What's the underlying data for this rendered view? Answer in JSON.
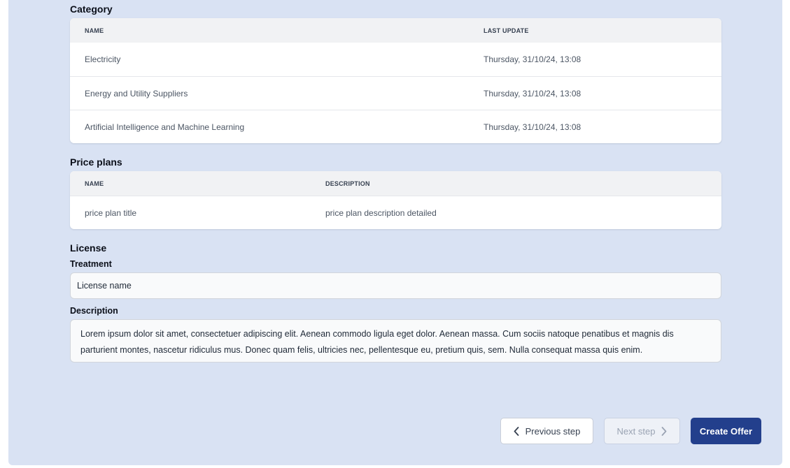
{
  "category": {
    "title": "Category",
    "headers": {
      "name": "NAME",
      "last_update": "LAST UPDATE"
    },
    "rows": [
      {
        "name": "Electricity",
        "last_update": "Thursday, 31/10/24, 13:08"
      },
      {
        "name": "Energy and Utility Suppliers",
        "last_update": "Thursday, 31/10/24, 13:08"
      },
      {
        "name": "Artificial Intelligence and Machine Learning",
        "last_update": "Thursday, 31/10/24, 13:08"
      }
    ]
  },
  "price_plans": {
    "title": "Price plans",
    "headers": {
      "name": "NAME",
      "description": "DESCRIPTION"
    },
    "rows": [
      {
        "name": "price plan title",
        "description": "price plan description detailed"
      }
    ]
  },
  "license": {
    "title": "License",
    "treatment_label": "Treatment",
    "treatment_value": "License name",
    "description_label": "Description",
    "description_value": "Lorem ipsum dolor sit amet, consectetuer adipiscing elit. Aenean commodo ligula eget dolor. Aenean massa. Cum sociis natoque penatibus et magnis dis parturient montes, nascetur ridiculus mus. Donec quam felis, ultricies nec, pellentesque eu, pretium quis, sem. Nulla consequat massa quis enim."
  },
  "actions": {
    "previous_label": "Previous step",
    "next_label": "Next step",
    "create_label": "Create Offer"
  },
  "icons": {
    "previous": "chevron-left-icon",
    "next": "chevron-right-icon"
  },
  "colors": {
    "panel_bg": "#d9e2f3",
    "primary": "#233f8c",
    "disabled_text": "#9aa3b3"
  }
}
